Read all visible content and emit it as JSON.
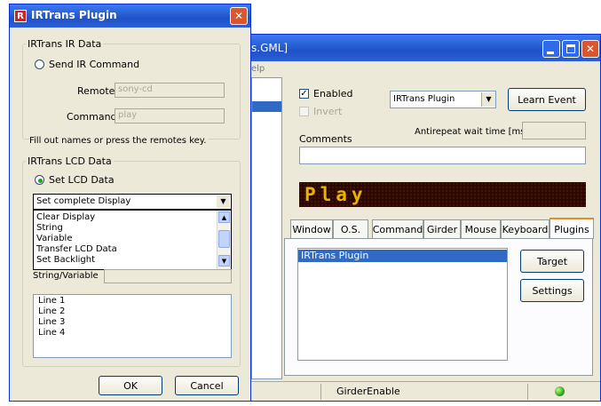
{
  "bg_window": {
    "title": "s.GML]",
    "menu_fragment": "elp",
    "enabled_label": "Enabled",
    "invert_label": "Invert",
    "plugin_select": "IRTrans Plugin",
    "learn_event_button": "Learn Event",
    "antirepeat_label": "Antirepeat wait time [ms]",
    "comments_label": "Comments",
    "display_text": "Play",
    "tabs": [
      "Window",
      "O.S.",
      "Command",
      "Girder",
      "Mouse",
      "Keyboard",
      "Plugins"
    ],
    "plugin_list": [
      "IRTrans Plugin"
    ],
    "target_button": "Target",
    "settings_button": "Settings",
    "status_text": "GirderEnable",
    "colors": {
      "titlebar": "#3a6fd8",
      "display_bg": "#2a0800",
      "display_text": "#e8b400"
    }
  },
  "dialog": {
    "title": "IRTrans Plugin",
    "ir_group_label": "IRTrans IR Data",
    "send_ir_label": "Send IR Command",
    "remote_label": "Remote",
    "remote_value": "sony-cd",
    "command_label": "Command",
    "command_value": "play",
    "hint_text": "Fill out names or press the remotes key.",
    "lcd_group_label": "IRTrans LCD Data",
    "set_lcd_label": "Set LCD Data",
    "lcd_action_selected": "Set complete Display",
    "lcd_action_options": [
      "Clear Display",
      "String",
      "Variable",
      "Transfer LCD Data",
      "Set Backlight"
    ],
    "string_variable_label": "String/Variable",
    "lines": [
      "Line 1",
      "Line 2",
      "Line 3",
      "Line 4"
    ],
    "ok_button": "OK",
    "cancel_button": "Cancel"
  }
}
